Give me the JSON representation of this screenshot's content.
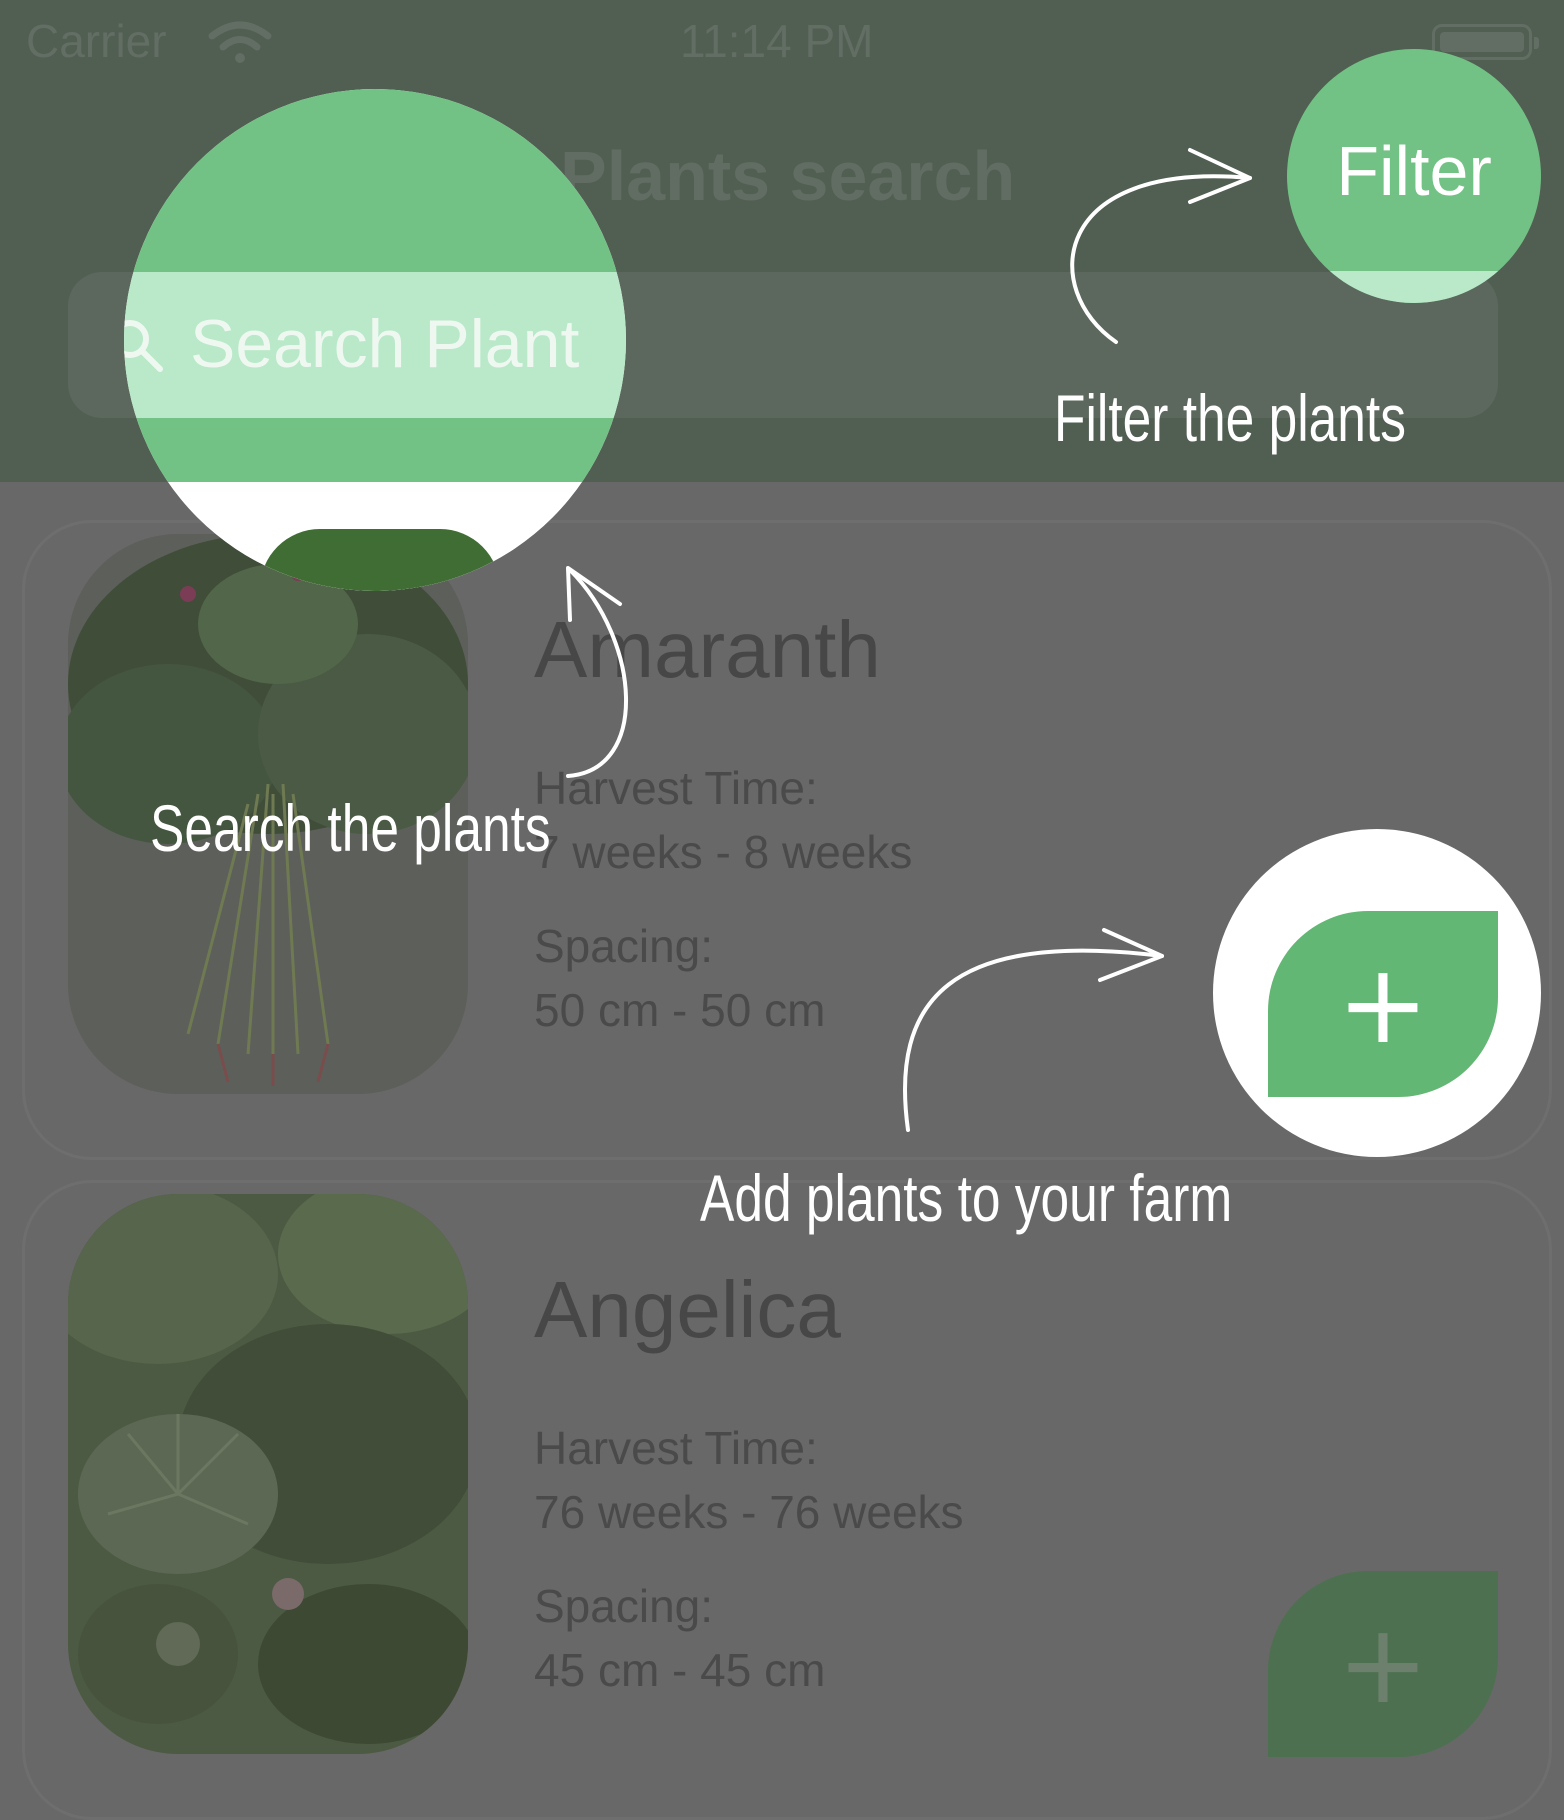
{
  "status_bar": {
    "carrier": "Carrier",
    "time": "11:14 PM",
    "wifi_icon": "wifi-icon",
    "battery_icon": "battery-icon"
  },
  "nav": {
    "title": "Plants search",
    "filter_label": "Filter"
  },
  "search": {
    "placeholder": "Search Plant",
    "icon": "search-icon"
  },
  "plants": [
    {
      "name": "Amaranth",
      "harvest_label": "Harvest Time:",
      "harvest_value": "7 weeks - 8 weeks",
      "spacing_label": "Spacing:",
      "spacing_value": "50 cm - 50 cm",
      "add_label": "+"
    },
    {
      "name": "Angelica",
      "harvest_label": "Harvest Time:",
      "harvest_value": "76 weeks - 76 weeks",
      "spacing_label": "Spacing:",
      "spacing_value": "45 cm - 45 cm",
      "add_label": "+"
    }
  ],
  "annotations": {
    "search": "Search the plants",
    "filter": "Filter the plants",
    "add": "Add plants to your farm"
  },
  "colors": {
    "accent_green": "#73c285",
    "button_green": "#63b774",
    "overlay_gray": "#686868",
    "header_dim": "#515e52"
  }
}
